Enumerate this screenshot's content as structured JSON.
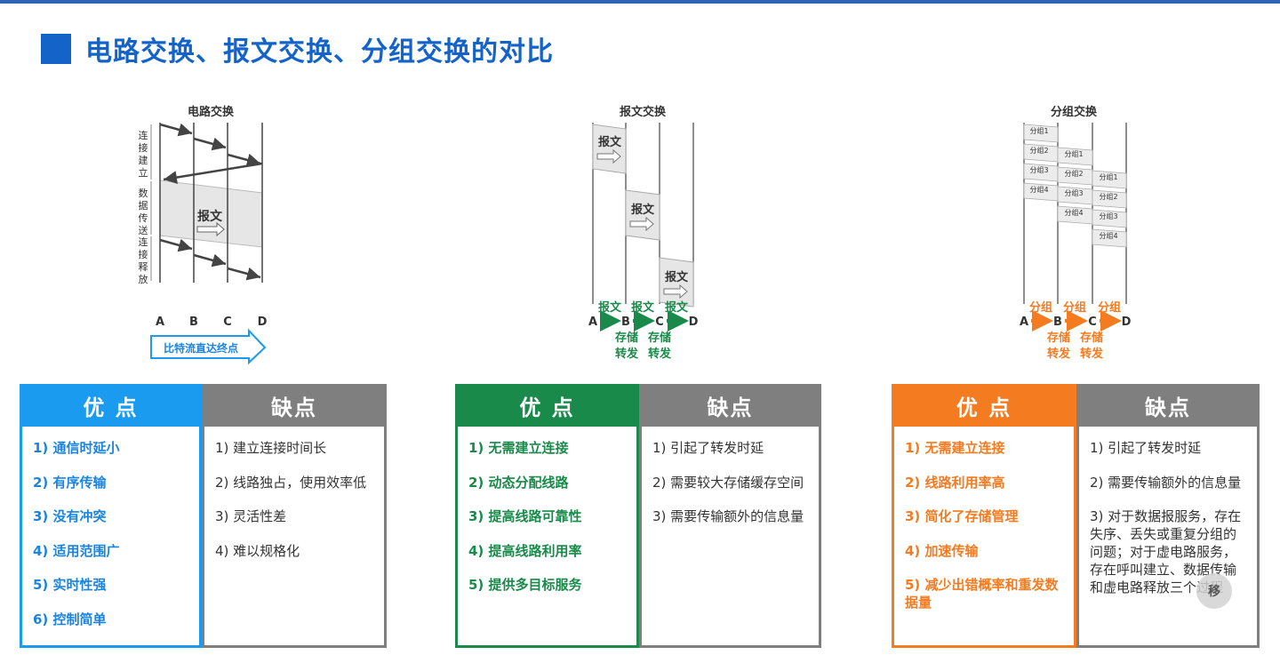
{
  "page": {
    "title": "电路交换、报文交换、分组交换的对比"
  },
  "diagrams": {
    "circuit": {
      "title": "电路交换",
      "nodes": [
        "A",
        "B",
        "C",
        "D"
      ],
      "phase_connect": "连接建立",
      "phase_data": "数据传送",
      "phase_release": "连接释放",
      "message_label": "报文",
      "banner": "比特流直达终点"
    },
    "message": {
      "title": "报文交换",
      "nodes": [
        "A",
        "B",
        "C",
        "D"
      ],
      "message_label": "报文",
      "hop_label": "报文",
      "store_top": "存储",
      "store_bottom": "转发"
    },
    "packet": {
      "title": "分组交换",
      "nodes": [
        "A",
        "B",
        "C",
        "D"
      ],
      "packets": [
        "分组1",
        "分组2",
        "分组3",
        "分组4"
      ],
      "hop_label": "分组",
      "store_top": "存储",
      "store_bottom": "转发"
    }
  },
  "panels": {
    "circuit": {
      "pros_title": "优  点",
      "pros": [
        "1) 通信时延小",
        "2) 有序传输",
        "3) 没有冲突",
        "4) 适用范围广",
        "5) 实时性强",
        "6) 控制简单"
      ],
      "cons_title": "缺点",
      "cons": [
        "1) 建立连接时间长",
        "2) 线路独占，使用效率低",
        "3) 灵活性差",
        "4) 难以规格化"
      ]
    },
    "message": {
      "pros_title": "优  点",
      "pros": [
        "1) 无需建立连接",
        "2) 动态分配线路",
        "3) 提高线路可靠性",
        "4) 提高线路利用率",
        "5) 提供多目标服务"
      ],
      "cons_title": "缺点",
      "cons": [
        "1) 引起了转发时延",
        "2) 需要较大存储缓存空间",
        "3) 需要传输额外的信息量"
      ]
    },
    "packet": {
      "pros_title": "优  点",
      "pros": [
        "1) 无需建立连接",
        "2) 线路利用率高",
        "3) 简化了存储管理",
        "4) 加速传输",
        "5)  减少出错概率和重发数据量"
      ],
      "cons_title": "缺点",
      "cons": [
        "1) 引起了转发时延",
        "2) 需要传输额外的信息量",
        "3) 对于数据报服务，存在失序、丢失或重复分组的问题；对于虚电路服务，存在呼叫建立、数据传输和虚电路释放三个过程"
      ]
    }
  },
  "colors": {
    "title_blue": "#1363c9",
    "circuit_accent": "#1a9bf0",
    "message_accent": "#1a8a4a",
    "packet_accent": "#f47b20",
    "cons_gray": "#7f7f7f"
  },
  "overlay": {
    "label": "移"
  }
}
